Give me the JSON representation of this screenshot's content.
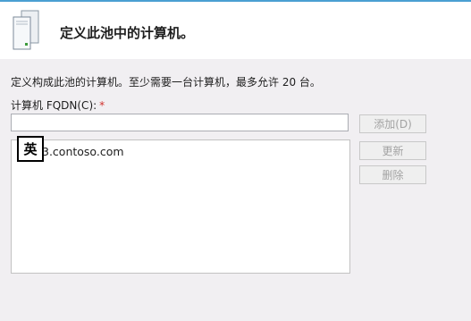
{
  "dialog": {
    "title": "定义此池中的计算机。",
    "description": "定义构成此池的计算机。至少需要一台计算机，最多允许 20 台。"
  },
  "fqdn_field": {
    "label": "计算机 FQDN(C):",
    "required_mark": "*",
    "value": ""
  },
  "buttons": {
    "add": "添加(D)",
    "update": "更新",
    "delete": "删除"
  },
  "computer_list": {
    "items": [
      {
        "label": "3.contoso.com"
      }
    ]
  },
  "ime_indicator": {
    "label": "英"
  },
  "colors": {
    "accent_bar": "#4a9fd2",
    "required": "#d0312d",
    "disabled_text": "#a3a3a3"
  }
}
